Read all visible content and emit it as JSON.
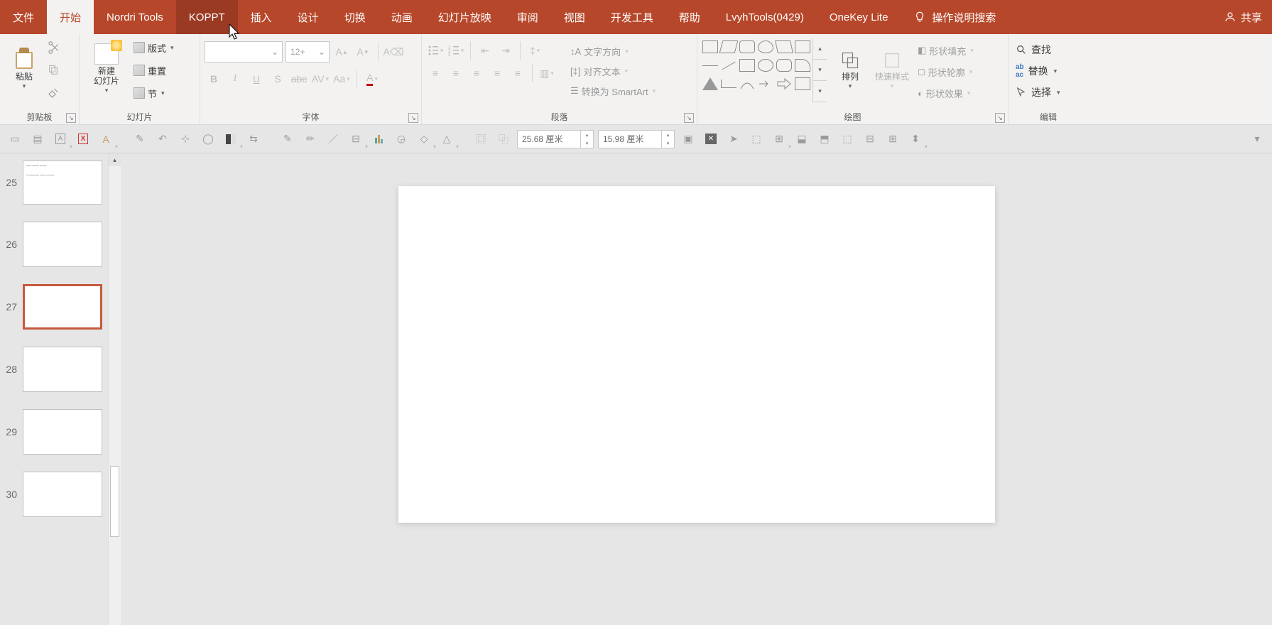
{
  "tabs": {
    "file": "文件",
    "home": "开始",
    "nordri": "Nordri Tools",
    "koppt": "KOPPT",
    "insert": "插入",
    "design": "设计",
    "transitions": "切换",
    "animations": "动画",
    "slideshow": "幻灯片放映",
    "review": "审阅",
    "view": "视图",
    "developer": "开发工具",
    "help": "帮助",
    "lvyh": "LvyhTools(0429)",
    "onekey": "OneKey Lite",
    "tellme": "操作说明搜索",
    "share": "共享"
  },
  "clipboard": {
    "paste": "粘贴",
    "group_label": "剪贴板"
  },
  "slides": {
    "new_slide": "新建\n幻灯片",
    "layout": "版式",
    "reset": "重置",
    "section": "节",
    "group_label": "幻灯片"
  },
  "font": {
    "size_placeholder": "12+",
    "group_label": "字体"
  },
  "paragraph": {
    "text_direction": "文字方向",
    "align_text": "对齐文本",
    "convert_smartart": "转换为 SmartArt",
    "group_label": "段落"
  },
  "drawing": {
    "arrange": "排列",
    "quick_styles": "快速样式",
    "shape_fill": "形状填充",
    "shape_outline": "形状轮廓",
    "shape_effects": "形状效果",
    "group_label": "绘图"
  },
  "editing": {
    "find": "查找",
    "replace": "替换",
    "select": "选择",
    "group_label": "编辑"
  },
  "quicktool": {
    "width_value": "25.68 厘米",
    "height_value": "15.98 厘米"
  },
  "thumbs": {
    "nums": [
      "25",
      "26",
      "27",
      "28",
      "29",
      "30"
    ],
    "active_index": 2
  }
}
